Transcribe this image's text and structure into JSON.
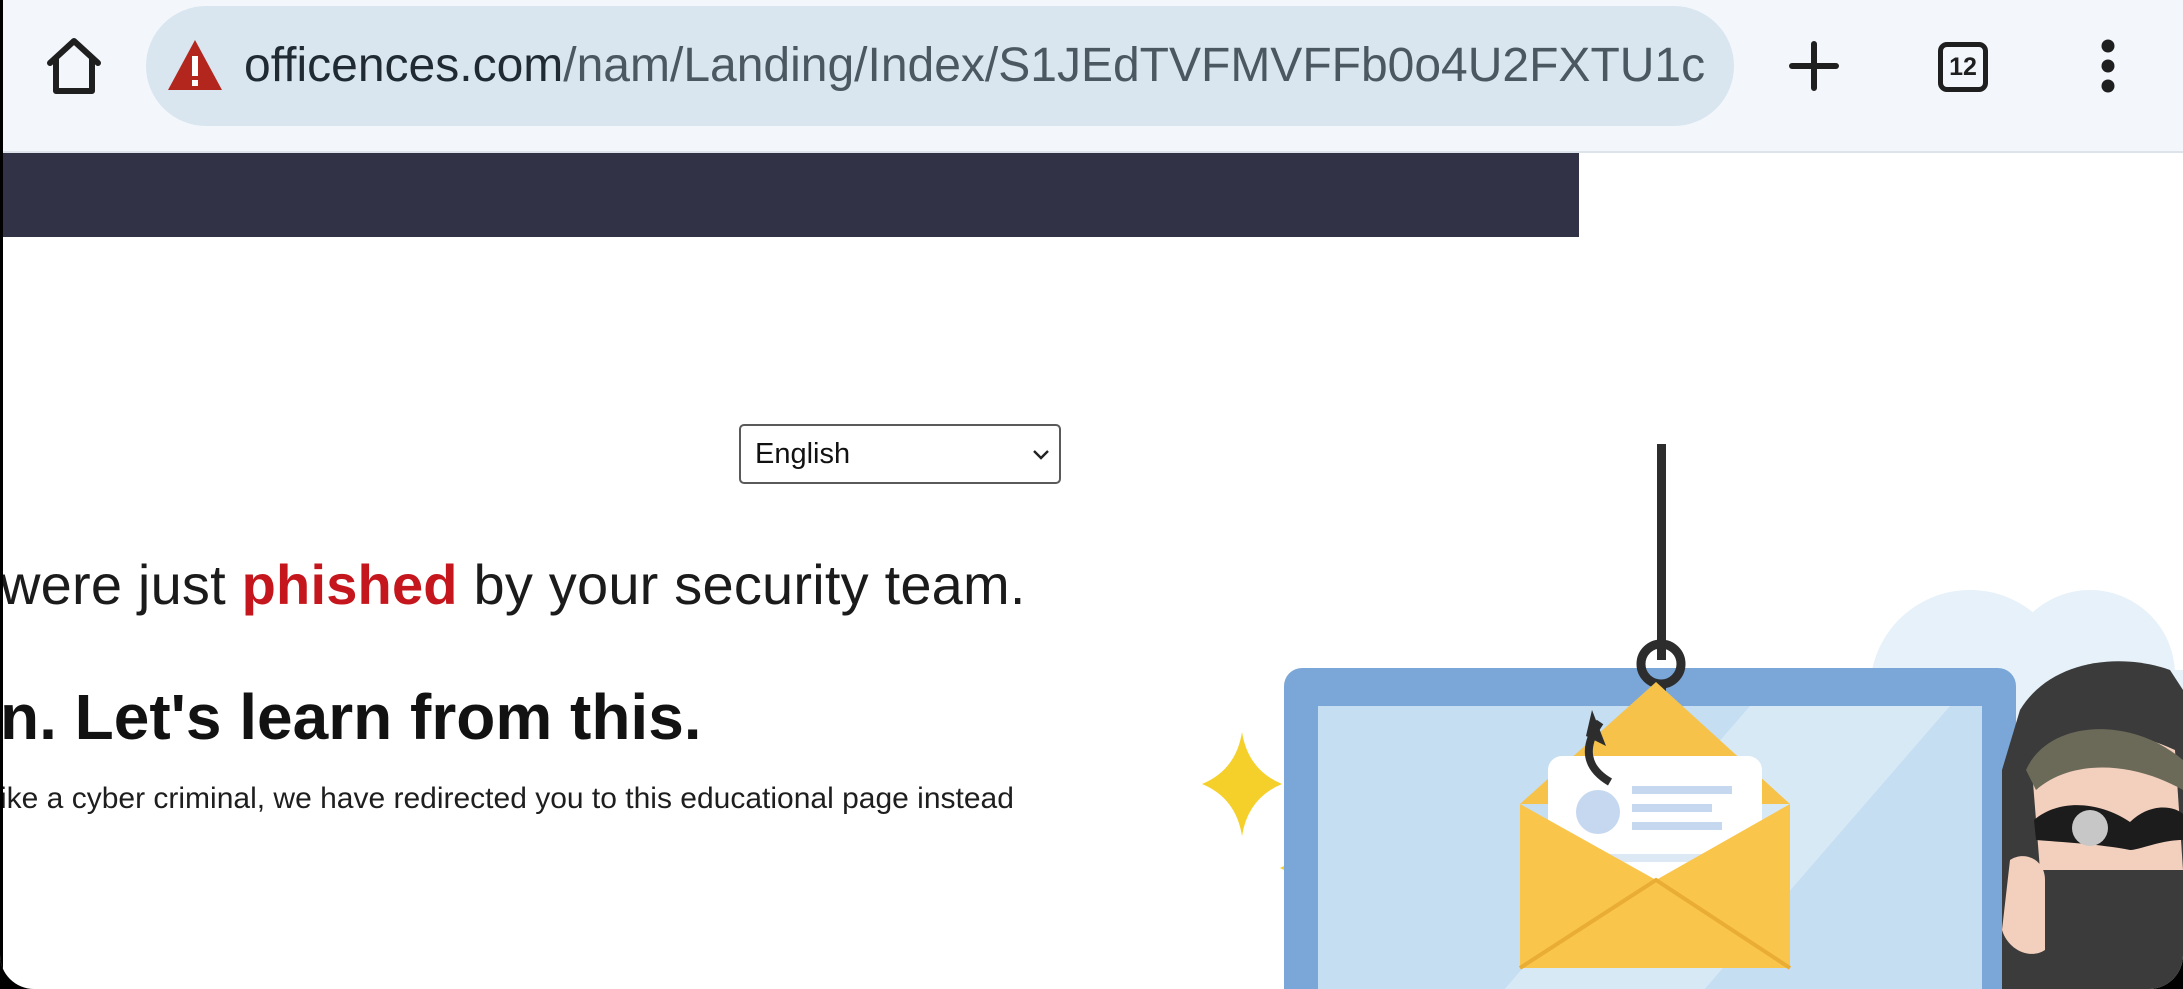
{
  "browser": {
    "url_domain": "officences.com",
    "url_path": "/nam/Landing/Index/S1JEdTVFMVFFb0o4U2FXTU1c",
    "tab_count": "12",
    "icons": {
      "home": "home-icon",
      "warning": "warning-triangle-icon",
      "new_tab": "plus-icon",
      "menu": "more-vert-icon"
    }
  },
  "page": {
    "language": "English",
    "headline_pre": "were just ",
    "headline_emph": "phished",
    "headline_post": " by your security team.",
    "subheadline": "n. Let's learn from this.",
    "body": "ike a cyber criminal, we have redirected you to this educational page instead"
  },
  "colors": {
    "accent_red": "#c4161c",
    "navy_band": "#323246",
    "toolbar_bg": "#f3f7fc",
    "urlbar_bg": "#d9e6ef"
  }
}
